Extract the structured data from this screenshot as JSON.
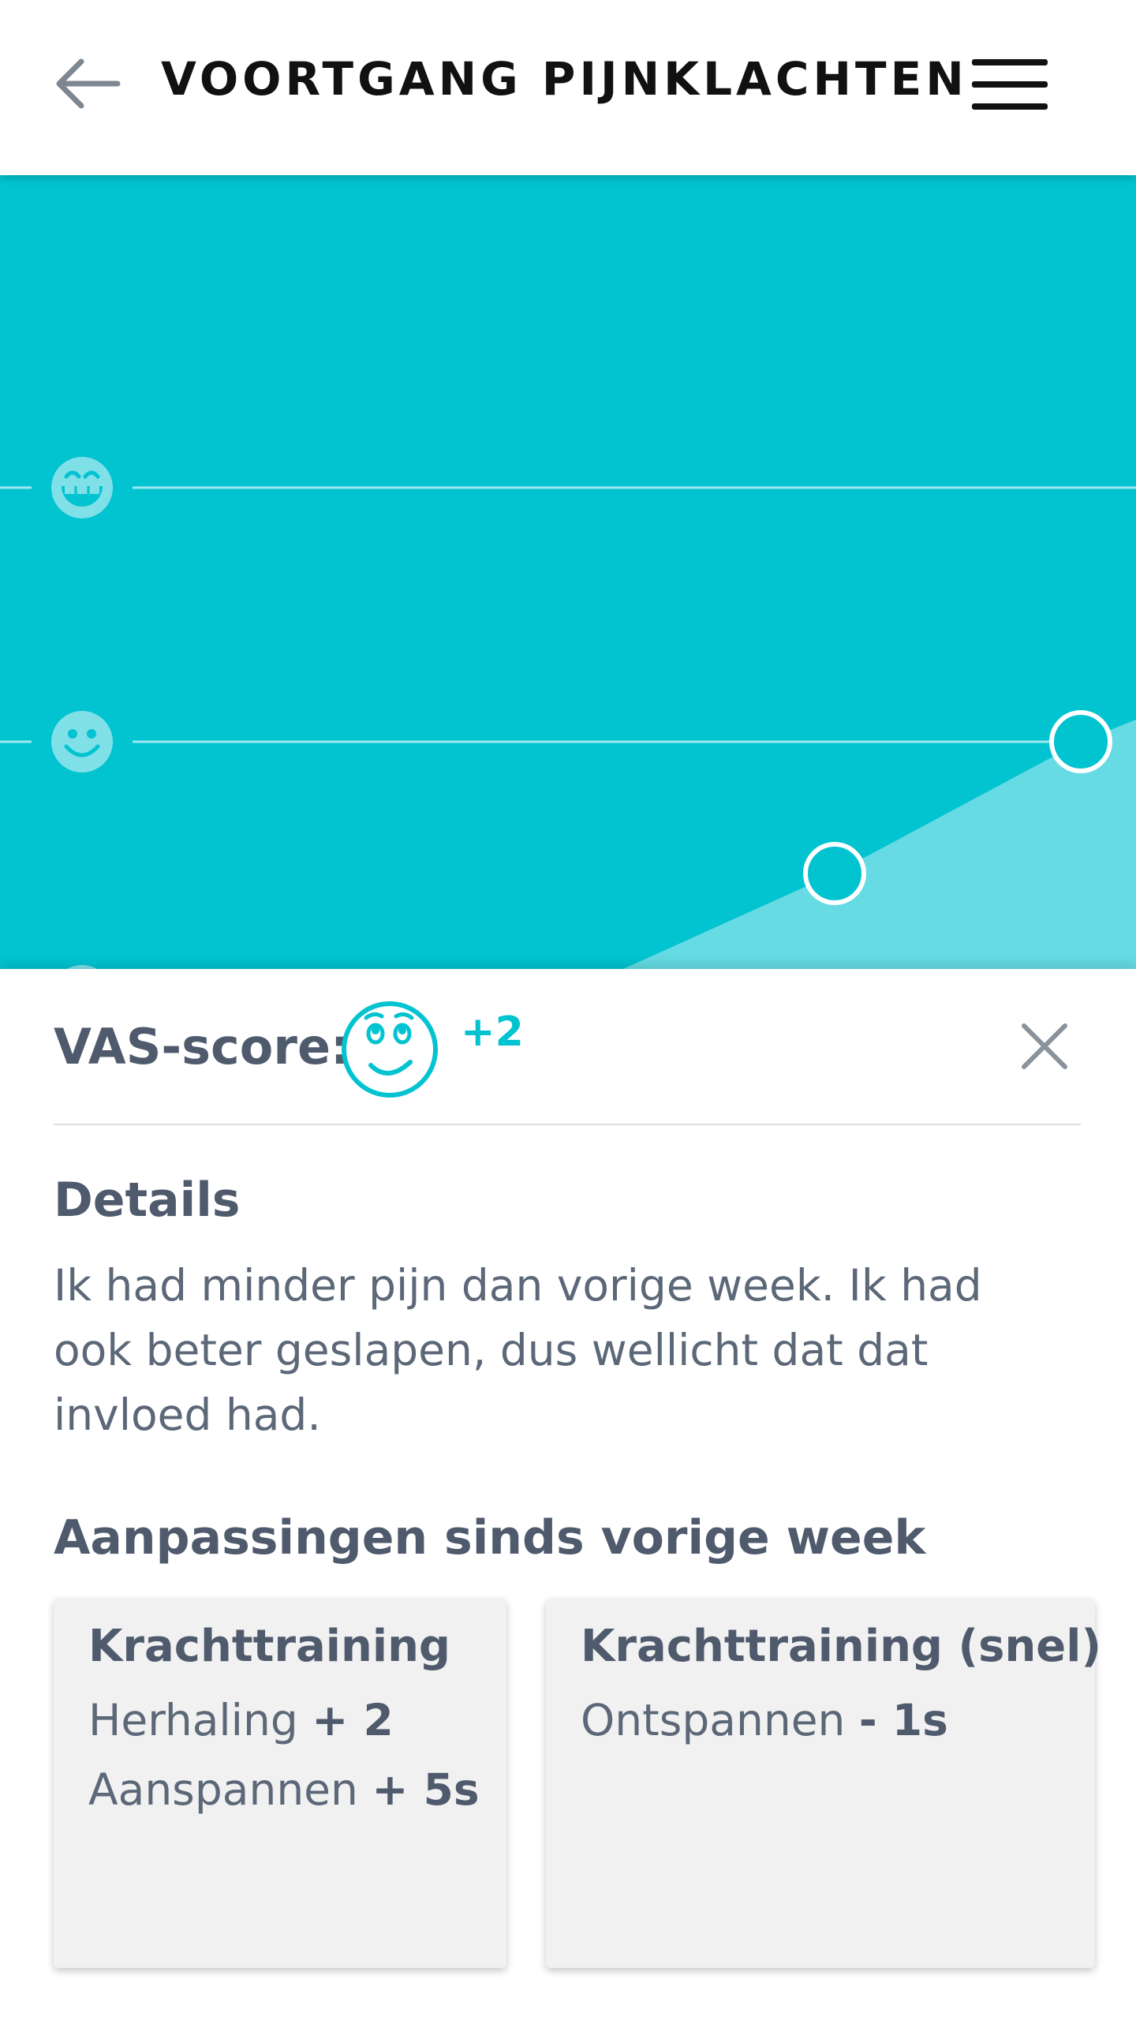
{
  "header": {
    "title": "VOORTGANG PIJNKLACHTEN",
    "back_icon": "arrow-left-icon",
    "menu_icon": "hamburger-menu-icon"
  },
  "chart": {
    "levels": [
      "very-happy-face-icon",
      "happy-face-icon"
    ],
    "colors": {
      "background": "#02c3d0",
      "area": "#66dbe3",
      "line": "#9ee9ef",
      "marker": "#ffffff"
    }
  },
  "vas": {
    "label": "VAS-score:",
    "face_icon": "relieved-face-icon",
    "delta": "+2",
    "close_icon": "close-icon"
  },
  "details": {
    "title": "Details",
    "text": "Ik had minder pijn dan vorige week. Ik had ook beter geslapen, dus wellicht dat dat invloed had."
  },
  "changes": {
    "title": "Aanpassingen sinds vorige week",
    "cards": [
      {
        "title": "Krachttraining",
        "lines": [
          {
            "label": "Herhaling",
            "value": "+ 2"
          },
          {
            "label": "Aanspannen",
            "value": "+ 5s"
          }
        ]
      },
      {
        "title": "Krachttraining (snel)",
        "lines": [
          {
            "label": "Ontspannen",
            "value": "- 1s"
          }
        ]
      }
    ]
  },
  "colors": {
    "accent": "#02c3d0",
    "text_dark": "#4f5b6d",
    "text": "#5c6878",
    "card_bg": "#f1f1f1"
  }
}
